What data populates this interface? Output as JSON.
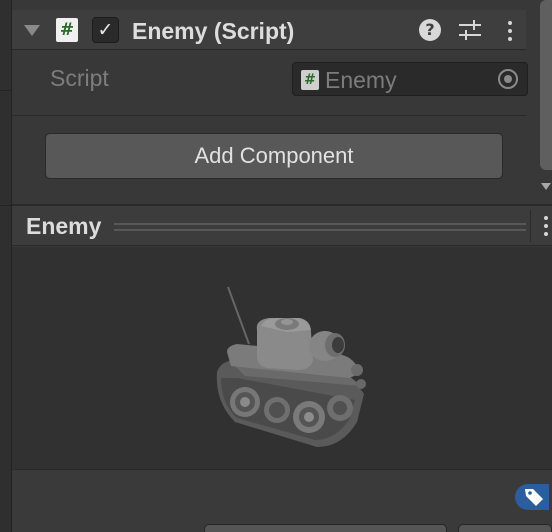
{
  "component": {
    "title": "Enemy (Script)",
    "enabled": true,
    "icon": "csharp-script-icon",
    "check_glyph": "✓",
    "hash_glyph": "#",
    "help_glyph": "?"
  },
  "script_field": {
    "label": "Script",
    "value": "Enemy"
  },
  "add_component_label": "Add Component",
  "preview": {
    "title": "Enemy",
    "subject": "tank-model"
  },
  "icons": [
    "foldout-arrow-icon",
    "help-icon",
    "presets-icon",
    "kebab-menu-icon",
    "object-picker-icon",
    "asset-label-icon"
  ],
  "colors": {
    "accent": "#2c5d9e",
    "panel": "#383838",
    "preview_bg": "#313131"
  }
}
